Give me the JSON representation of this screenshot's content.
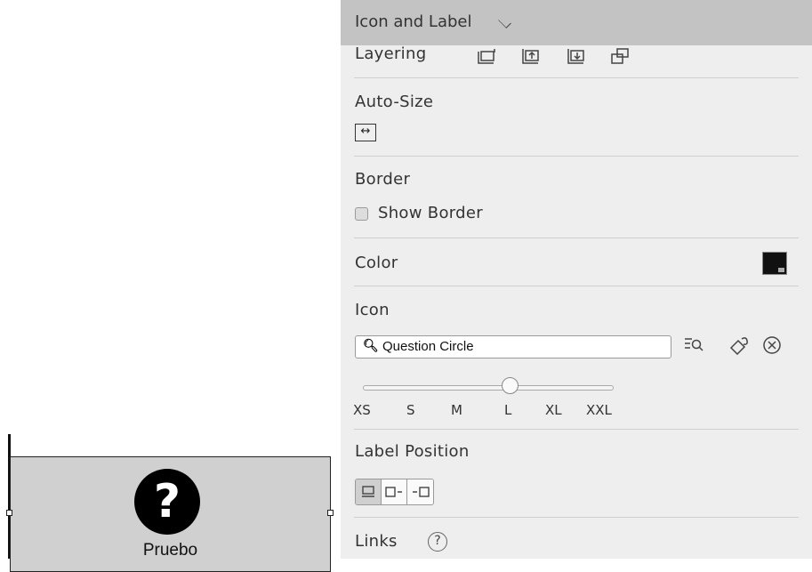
{
  "canvas": {
    "widget_label": "Pruebo",
    "icon_glyph": "?"
  },
  "panel": {
    "header_title": "Icon and Label",
    "layering_label": "Layering",
    "autosize_label": "Auto-Size",
    "border_label": "Border",
    "show_border_label": "Show Border",
    "show_border_checked": false,
    "color_label": "Color",
    "color_value": "#111111",
    "icon_label": "Icon",
    "icon_value": "Question Circle",
    "size_options": [
      "XS",
      "S",
      "M",
      "L",
      "XL",
      "XXL"
    ],
    "size_selected": "L",
    "label_position_label": "Label Position",
    "links_label": "Links"
  }
}
